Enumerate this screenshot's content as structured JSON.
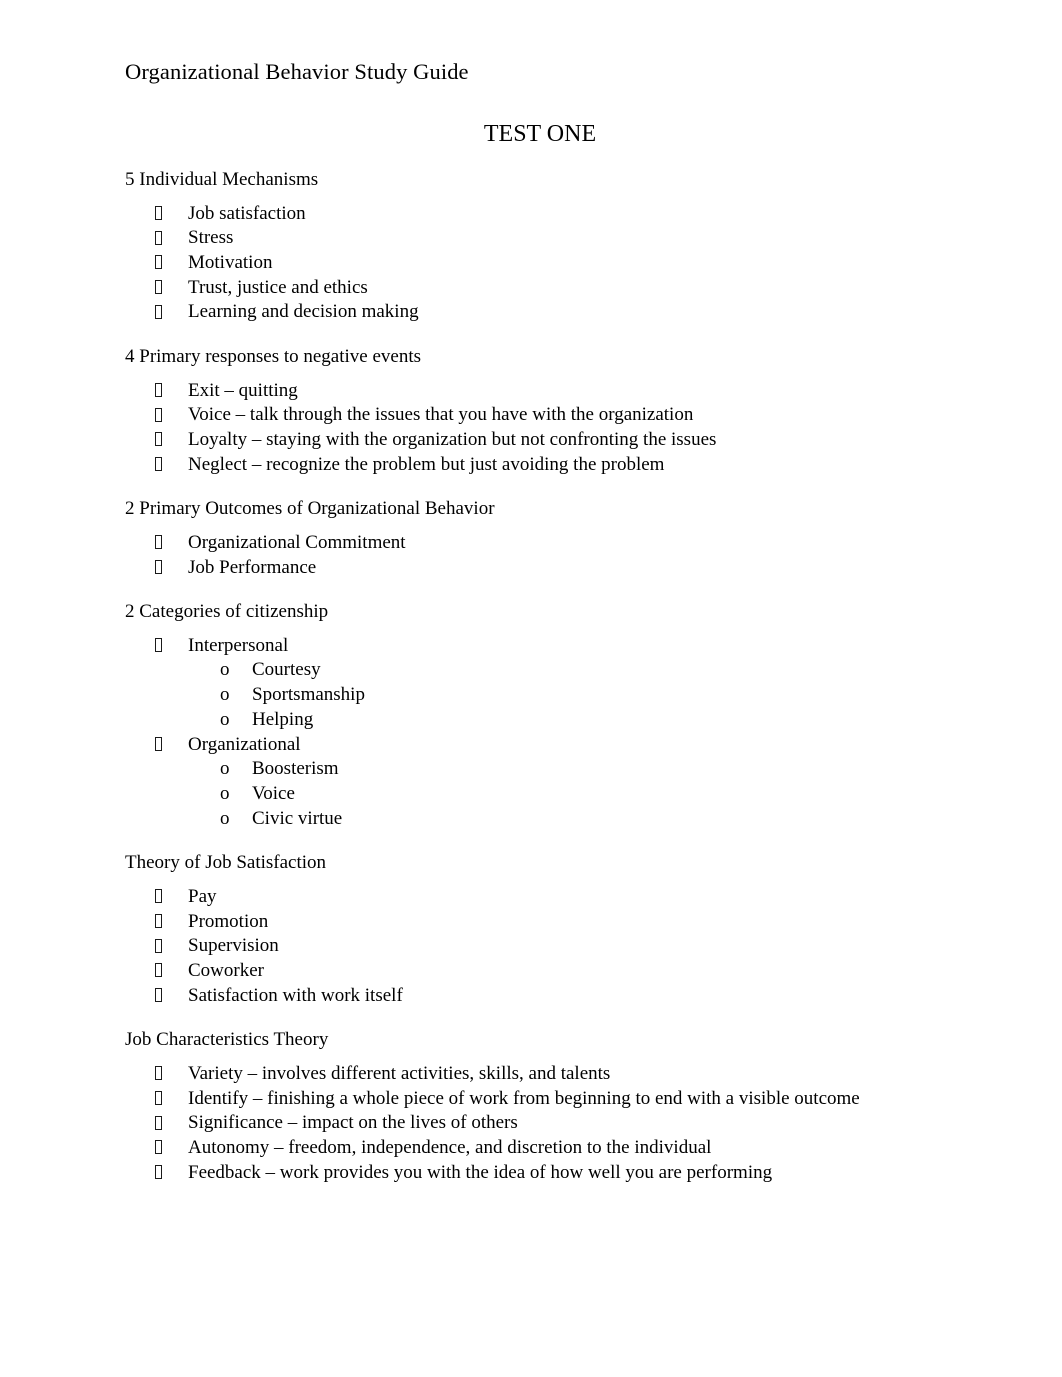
{
  "document": {
    "title": "Organizational Behavior Study Guide",
    "test_title": "TEST ONE",
    "bullet_glyph": "missing-glyph-box",
    "sub_bullet_marker": "o",
    "text_color": "#000000",
    "background_color": "#ffffff"
  },
  "sections": [
    {
      "heading": "5 Individual Mechanisms",
      "items": [
        {
          "text": "Job satisfaction"
        },
        {
          "text": "Stress"
        },
        {
          "text": "Motivation"
        },
        {
          "text": "Trust, justice and ethics"
        },
        {
          "text": "Learning and decision making"
        }
      ]
    },
    {
      "heading": "4 Primary responses to negative events",
      "items": [
        {
          "text": "Exit – quitting"
        },
        {
          "text": "Voice – talk through the issues that you have with the organization"
        },
        {
          "text": "Loyalty – staying with the organization but not confronting the issues"
        },
        {
          "text": "Neglect – recognize the problem but just avoiding the problem"
        }
      ]
    },
    {
      "heading": "2 Primary Outcomes of Organizational Behavior",
      "items": [
        {
          "text": "Organizational Commitment"
        },
        {
          "text": "Job Performance"
        }
      ]
    },
    {
      "heading": "2 Categories of citizenship",
      "items": [
        {
          "text": "Interpersonal",
          "subitems": [
            {
              "text": "Courtesy"
            },
            {
              "text": "Sportsmanship"
            },
            {
              "text": "Helping"
            }
          ]
        },
        {
          "text": "Organizational",
          "subitems": [
            {
              "text": "Boosterism"
            },
            {
              "text": "Voice"
            },
            {
              "text": "Civic virtue"
            }
          ]
        }
      ]
    },
    {
      "heading": "Theory of Job Satisfaction",
      "items": [
        {
          "text": "Pay"
        },
        {
          "text": "Promotion"
        },
        {
          "text": "Supervision"
        },
        {
          "text": "Coworker"
        },
        {
          "text": "Satisfaction with work itself"
        }
      ]
    },
    {
      "heading": "Job Characteristics Theory",
      "items": [
        {
          "text": "Variety – involves different activities, skills, and talents"
        },
        {
          "text": "Identify – finishing a whole piece of work from beginning to end with a visible outcome"
        },
        {
          "text": "Significance – impact on the lives of others"
        },
        {
          "text": "Autonomy – freedom, independence, and discretion to the individual"
        },
        {
          "text": "Feedback – work provides you with the idea of how well you are performing"
        }
      ]
    }
  ]
}
